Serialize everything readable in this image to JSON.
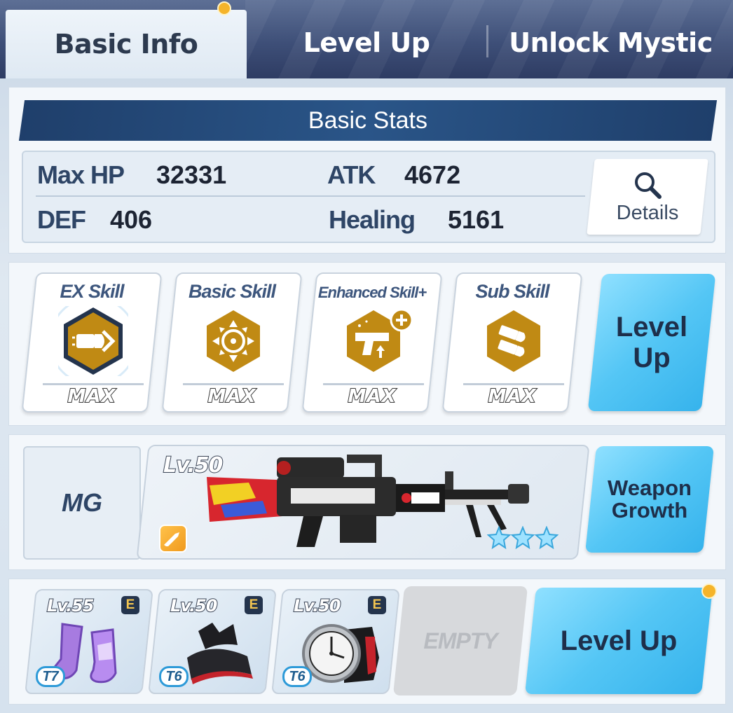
{
  "tabs": [
    {
      "label": "Basic Info",
      "active": true
    },
    {
      "label": "Level Up",
      "active": false
    },
    {
      "label": "Unlock Mystic",
      "active": false
    }
  ],
  "stats": {
    "header": "Basic Stats",
    "max_hp_label": "Max HP",
    "max_hp_value": "32331",
    "atk_label": "ATK",
    "atk_value": "4672",
    "def_label": "DEF",
    "def_value": "406",
    "healing_label": "Healing",
    "healing_value": "5161",
    "details_label": "Details"
  },
  "skills": {
    "items": [
      {
        "name": "EX Skill",
        "level": "MAX",
        "icon": "bullet-burst-icon"
      },
      {
        "name": "Basic Skill",
        "level": "MAX",
        "icon": "crosshair-icon"
      },
      {
        "name": "Enhanced Skill+",
        "level": "MAX",
        "icon": "pistol-upgrade-icon"
      },
      {
        "name": "Sub Skill",
        "level": "MAX",
        "icon": "bullets-icon"
      }
    ],
    "level_up_line1": "Level",
    "level_up_line2": "Up"
  },
  "weapon": {
    "type": "MG",
    "level": "Lv.50",
    "stars": 3,
    "growth_line1": "Weapon",
    "growth_line2": "Growth"
  },
  "gear": {
    "items": [
      {
        "level": "Lv.55",
        "tier": "T7",
        "grade": "E",
        "icon": "boots-icon"
      },
      {
        "level": "Lv.50",
        "tier": "T6",
        "grade": "E",
        "icon": "hat-icon"
      },
      {
        "level": "Lv.50",
        "tier": "T6",
        "grade": "E",
        "icon": "watch-icon"
      }
    ],
    "empty_label": "EMPTY",
    "level_up_label": "Level Up"
  },
  "colors": {
    "accent_blue": "#54c6f5",
    "header_navy": "#2a5588",
    "skill_gold": "#c08a14",
    "notification": "#f5b42a"
  }
}
